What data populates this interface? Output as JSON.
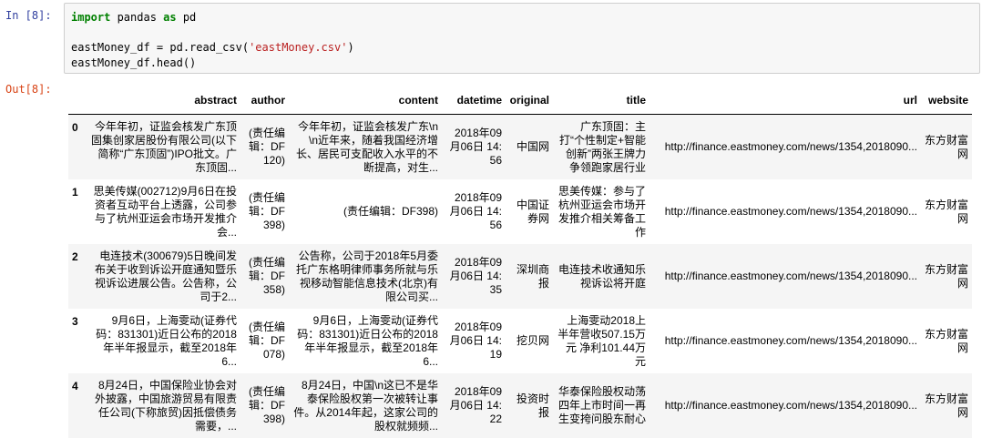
{
  "input_prompt": "In [8]:",
  "output_prompt": "Out[8]:",
  "code": {
    "line1": {
      "kw1": "import",
      "mid": " pandas ",
      "kw2": "as",
      "end": " pd"
    },
    "line3": {
      "pre": "eastMoney_df = pd.read_csv(",
      "str": "'eastMoney.csv'",
      "post": ")"
    },
    "line4": "eastMoney_df.head()"
  },
  "table": {
    "columns": [
      "",
      "abstract",
      "author",
      "content",
      "datetime",
      "original",
      "title",
      "url",
      "website"
    ],
    "rows": [
      {
        "index": "0",
        "abstract": "今年年初，证监会核发广东顶固集创家居股份有限公司(以下简称“广东顶固”)IPO批文。广东顶固...",
        "author": "(责任编辑：DF120)",
        "content": "今年年初，证监会核发广东\\n\\n近年来，随着我国经济增长、居民可支配收入水平的不断提高，对生...",
        "datetime": "2018年09月06日 14:56",
        "original": "中国网",
        "title": "广东顶固：主打“个性制定+智能创新”两张王牌力争领跑家居行业",
        "url": "http://finance.eastmoney.com/news/1354,2018090...",
        "website": "东方财富网"
      },
      {
        "index": "1",
        "abstract": "思美传媒(002712)9月6日在投资者互动平台上透露，公司参与了杭州亚运会市场开发推介会...",
        "author": "(责任编辑：DF398)",
        "content": "(责任编辑：DF398)",
        "datetime": "2018年09月06日 14:56",
        "original": "中国证券网",
        "title": "思美传媒：参与了杭州亚运会市场开发推介相关筹备工作",
        "url": "http://finance.eastmoney.com/news/1354,2018090...",
        "website": "东方财富网"
      },
      {
        "index": "2",
        "abstract": "电连技术(300679)5日晚间发布关于收到诉讼开庭通知暨乐视诉讼进展公告。公告称，公司于2...",
        "author": "(责任编辑：DF358)",
        "content": "公告称，公司于2018年5月委托广东格明律师事务所就与乐视移动智能信息技术(北京)有限公司买...",
        "datetime": "2018年09月06日 14:35",
        "original": "深圳商报",
        "title": "电连技术收通知乐视诉讼将开庭",
        "url": "http://finance.eastmoney.com/news/1354,2018090...",
        "website": "东方财富网"
      },
      {
        "index": "3",
        "abstract": "9月6日，上海雯动(证券代码：831301)近日公布的2018年半年报显示，截至2018年6...",
        "author": "(责任编辑：DF078)",
        "content": "9月6日，上海雯动(证券代码：831301)近日公布的2018年半年报显示，截至2018年6...",
        "datetime": "2018年09月06日 14:19",
        "original": "挖贝网",
        "title": "上海雯动2018上半年营收507.15万元 净利101.44万元",
        "url": "http://finance.eastmoney.com/news/1354,2018090...",
        "website": "东方财富网"
      },
      {
        "index": "4",
        "abstract": "8月24日，中国保险业协会对外披露，中国旅游贸易有限责任公司(下称旅贸)因抵偿债务需要，...",
        "author": "(责任编辑：DF398)",
        "content": "8月24日，中国\\n这已不是华泰保险股权第一次被转让事件。从2014年起，这家公司的股权就频频...",
        "datetime": "2018年09月06日 14:22",
        "original": "投资时报",
        "title": "华泰保险股权动荡四年上市时间一再生变挎问股东耐心",
        "url": "http://finance.eastmoney.com/news/1354,2018090...",
        "website": "东方财富网"
      }
    ]
  }
}
